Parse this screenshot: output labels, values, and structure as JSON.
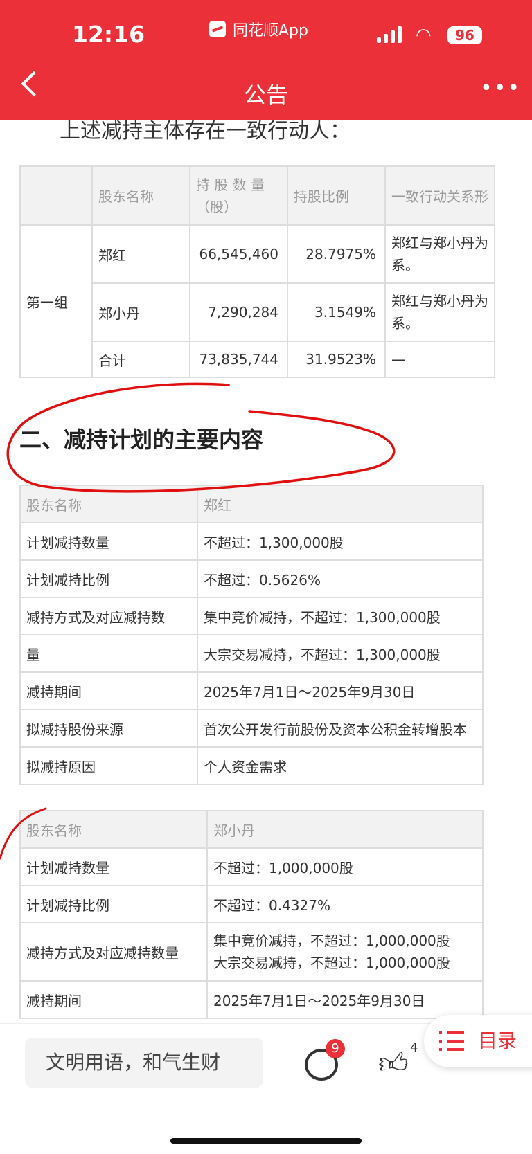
{
  "status_bar": {
    "time": "12:16",
    "app_name": "同花顺App",
    "battery": "96"
  },
  "nav": {
    "title": "公告",
    "back_icon": "chevron-left-icon",
    "more_icon": "more-icon",
    "more_glyph": "•••"
  },
  "intro_text": "上述减持主体存在一致行动人：",
  "holders_table": {
    "headers": [
      "",
      "股东名称",
      "持 股 数 量 （股）",
      "持股比例",
      "一致行动关系形"
    ],
    "group_label": "第一组",
    "rows": [
      {
        "name": "郑红",
        "shares": "66,545,460",
        "ratio": "28.7975%",
        "relation": "郑红与郑小丹为 系。"
      },
      {
        "name": "郑小丹",
        "shares": "7,290,284",
        "ratio": "3.1549%",
        "relation": "郑红与郑小丹为 系。"
      },
      {
        "name": "合计",
        "shares": "73,835,744",
        "ratio": "31.9523%",
        "relation": "—"
      }
    ]
  },
  "section_title": "二、减持计划的主要内容",
  "plan1": {
    "header": {
      "label": "股东名称",
      "value": "郑红"
    },
    "rows": [
      {
        "label": "计划减持数量",
        "value": "不超过：1,300,000股"
      },
      {
        "label": "计划减持比例",
        "value": "不超过：0.5626%"
      },
      {
        "label": "减持方式及对应减持数",
        "value": "集中竞价减持，不超过：1,300,000股"
      },
      {
        "label": "量",
        "value": "大宗交易减持，不超过：1,300,000股"
      },
      {
        "label": "减持期间",
        "value": "2025年7月1日～2025年9月30日"
      },
      {
        "label": "拟减持股份来源",
        "value": "首次公开发行前股份及资本公积金转增股本"
      },
      {
        "label": "拟减持原因",
        "value": "个人资金需求"
      }
    ]
  },
  "plan2": {
    "header": {
      "label": "股东名称",
      "value": "郑小丹"
    },
    "rows": [
      {
        "label": "计划减持数量",
        "value": "不超过：1,000,000股"
      },
      {
        "label": "计划减持比例",
        "value": "不超过：0.4327%"
      },
      {
        "label": "减持方式及对应减持数量",
        "value": "集中竞价减持，不超过：1,000,000股",
        "value2": "大宗交易减持，不超过：1,000,000股"
      },
      {
        "label": "减持期间",
        "value": "2025年7月1日～2025年9月30日"
      }
    ]
  },
  "bottom_bar": {
    "comment_placeholder": "文明用语，和气生财",
    "comment_badge": "9",
    "like_count": "4"
  },
  "toc_button": {
    "label": "目录",
    "icon": "list-icon"
  },
  "colors": {
    "brand_red": "#ec3039",
    "annotation_red": "#e01010"
  }
}
